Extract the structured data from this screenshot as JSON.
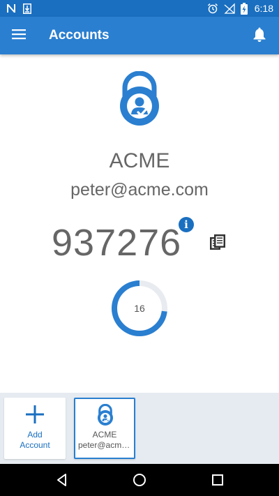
{
  "status_bar": {
    "time": "6:18",
    "icons_left": [
      "nfc-n-icon",
      "download-notification-icon"
    ],
    "icons_right": [
      "alarm-icon",
      "no-signal-icon",
      "battery-charging-icon"
    ]
  },
  "app_bar": {
    "title": "Accounts",
    "menu_icon": "hamburger-menu-icon",
    "notification_icon": "bell-icon"
  },
  "account": {
    "issuer": "ACME",
    "email": "peter@acme.com",
    "code": "937276",
    "info_icon_glyph": "i",
    "seconds_remaining": "16",
    "timer_progress_fraction": 0.73
  },
  "tray": {
    "add_label_line1": "Add",
    "add_label_line2": "Account",
    "cards": [
      {
        "issuer": "ACME",
        "email": "peter@acme.com"
      }
    ]
  },
  "navigation": {
    "buttons": [
      "back-icon",
      "home-icon",
      "recents-icon"
    ]
  },
  "colors": {
    "app_bar": "#2a7fd0",
    "status_bar": "#1a6fc0",
    "accent": "#1a6fc0",
    "timer_track": "#e8ebef",
    "tray_background": "#e6ebf1",
    "text_gray": "#666666"
  }
}
